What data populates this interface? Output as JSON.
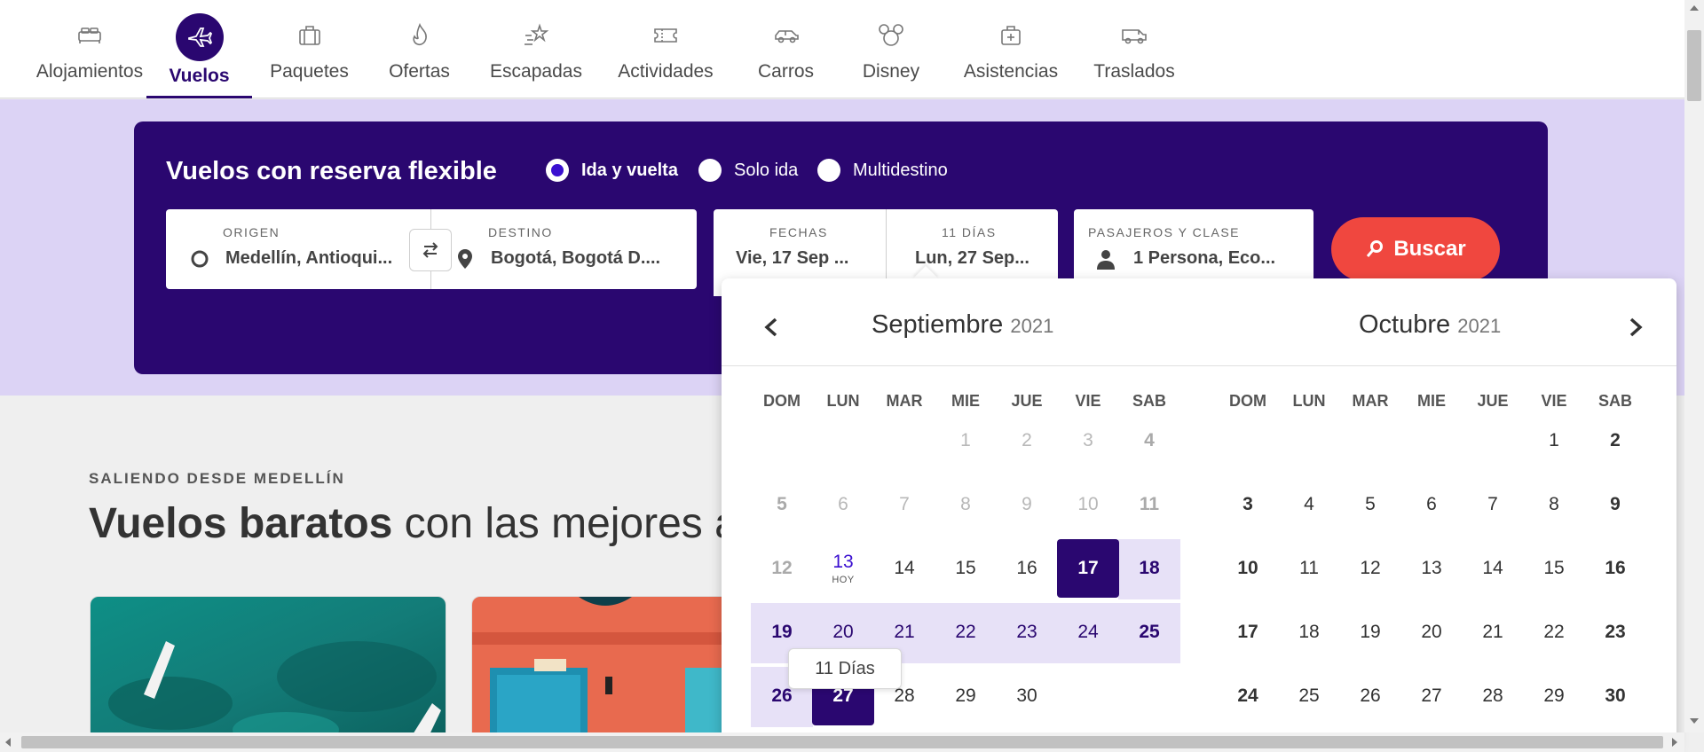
{
  "nav": {
    "items": [
      {
        "label": "Alojamientos",
        "icon": "bed-icon"
      },
      {
        "label": "Vuelos",
        "icon": "airplane-icon"
      },
      {
        "label": "Paquetes",
        "icon": "suitcase-icon"
      },
      {
        "label": "Ofertas",
        "icon": "flame-icon"
      },
      {
        "label": "Escapadas",
        "icon": "shooting-star-icon"
      },
      {
        "label": "Actividades",
        "icon": "ticket-icon"
      },
      {
        "label": "Carros",
        "icon": "car-icon"
      },
      {
        "label": "Disney",
        "icon": "mickey-icon"
      },
      {
        "label": "Asistencias",
        "icon": "medkit-icon"
      },
      {
        "label": "Traslados",
        "icon": "van-icon"
      }
    ],
    "active": "Vuelos"
  },
  "search": {
    "title": "Vuelos con reserva flexible",
    "trip_types": [
      "Ida y vuelta",
      "Solo ida",
      "Multidestino"
    ],
    "trip_type_selected": "Ida y vuelta",
    "origin_label": "ORIGEN",
    "origin_value": "Medellín, Antioqui...",
    "destination_label": "DESTINO",
    "destination_value": "Bogotá, Bogotá D....",
    "dates_label": "FECHAS",
    "date_start": "Vie, 17 Sep ...",
    "duration_label": "11 DÍAS",
    "date_end": "Lun, 27 Sep...",
    "passengers_label": "PASAJEROS Y CLASE",
    "passengers_value": "1 Persona, Eco...",
    "search_button": "Buscar"
  },
  "promo": {
    "eyebrow": "SALIENDO DESDE MEDELLÍN",
    "title_bold": "Vuelos baratos",
    "title_rest": " con las mejores a"
  },
  "datepicker": {
    "weekdays": [
      "DOM",
      "LUN",
      "MAR",
      "MIE",
      "JUE",
      "VIE",
      "SAB"
    ],
    "left_month": {
      "name": "Septiembre",
      "year": "2021"
    },
    "right_month": {
      "name": "Octubre",
      "year": "2021"
    },
    "today_label": "HOY",
    "tooltip": "11 Días",
    "selected_start": "17",
    "selected_end": "27"
  },
  "colors": {
    "brand": "#2a0770",
    "accent": "#f0473f",
    "range": "#e7e1f7"
  }
}
